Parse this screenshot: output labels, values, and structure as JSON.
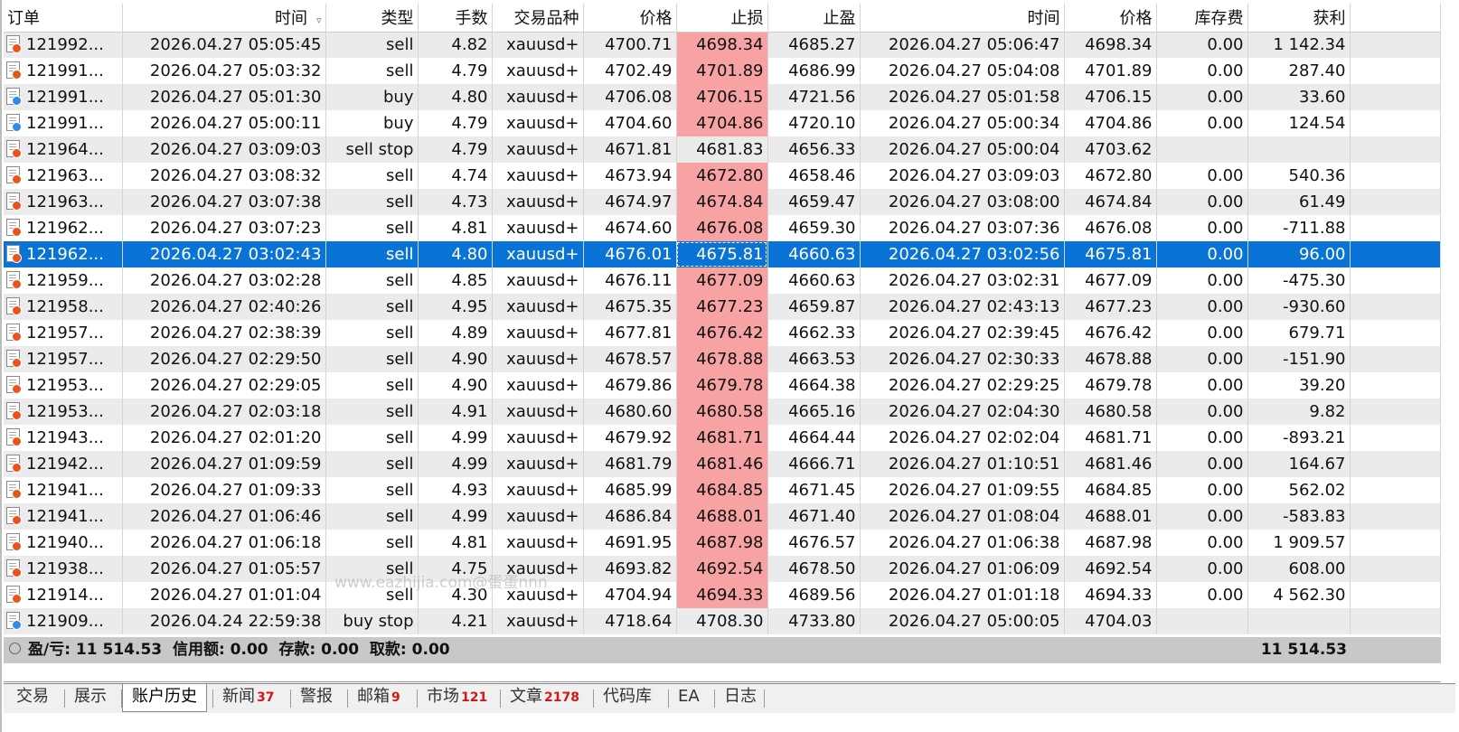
{
  "columns": [
    "订单",
    "时间",
    "类型",
    "手数",
    "交易品种",
    "价格",
    "止损",
    "止盈",
    "时间",
    "价格",
    "库存费",
    "获利"
  ],
  "sort_indicator": "▿",
  "rows": [
    {
      "order": "121992...",
      "open_time": "2026.04.27 05:05:45",
      "type": "sell",
      "volume": "4.82",
      "symbol": "xauusd+",
      "open_price": "4700.71",
      "sl": "4698.34",
      "tp": "4685.27",
      "close_time": "2026.04.27 05:06:47",
      "close_price": "4698.34",
      "swap": "0.00",
      "profit": "1 142.34",
      "sl_hit": true,
      "dot": "red"
    },
    {
      "order": "121991...",
      "open_time": "2026.04.27 05:03:32",
      "type": "sell",
      "volume": "4.79",
      "symbol": "xauusd+",
      "open_price": "4702.49",
      "sl": "4701.89",
      "tp": "4686.99",
      "close_time": "2026.04.27 05:04:08",
      "close_price": "4701.89",
      "swap": "0.00",
      "profit": "287.40",
      "sl_hit": true,
      "dot": "red"
    },
    {
      "order": "121991...",
      "open_time": "2026.04.27 05:01:30",
      "type": "buy",
      "volume": "4.80",
      "symbol": "xauusd+",
      "open_price": "4706.08",
      "sl": "4706.15",
      "tp": "4721.56",
      "close_time": "2026.04.27 05:01:58",
      "close_price": "4706.15",
      "swap": "0.00",
      "profit": "33.60",
      "sl_hit": true,
      "dot": "blue"
    },
    {
      "order": "121991...",
      "open_time": "2026.04.27 05:00:11",
      "type": "buy",
      "volume": "4.79",
      "symbol": "xauusd+",
      "open_price": "4704.60",
      "sl": "4704.86",
      "tp": "4720.10",
      "close_time": "2026.04.27 05:00:34",
      "close_price": "4704.86",
      "swap": "0.00",
      "profit": "124.54",
      "sl_hit": true,
      "dot": "blue"
    },
    {
      "order": "121964...",
      "open_time": "2026.04.27 03:09:03",
      "type": "sell stop",
      "volume": "4.79",
      "symbol": "xauusd+",
      "open_price": "4671.81",
      "sl": "4681.83",
      "tp": "4656.33",
      "close_time": "2026.04.27 05:00:04",
      "close_price": "4703.62",
      "swap": "",
      "profit": "",
      "sl_hit": false,
      "dot": "red"
    },
    {
      "order": "121963...",
      "open_time": "2026.04.27 03:08:32",
      "type": "sell",
      "volume": "4.74",
      "symbol": "xauusd+",
      "open_price": "4673.94",
      "sl": "4672.80",
      "tp": "4658.46",
      "close_time": "2026.04.27 03:09:03",
      "close_price": "4672.80",
      "swap": "0.00",
      "profit": "540.36",
      "sl_hit": true,
      "dot": "red"
    },
    {
      "order": "121963...",
      "open_time": "2026.04.27 03:07:38",
      "type": "sell",
      "volume": "4.73",
      "symbol": "xauusd+",
      "open_price": "4674.97",
      "sl": "4674.84",
      "tp": "4659.47",
      "close_time": "2026.04.27 03:08:00",
      "close_price": "4674.84",
      "swap": "0.00",
      "profit": "61.49",
      "sl_hit": true,
      "dot": "red"
    },
    {
      "order": "121962...",
      "open_time": "2026.04.27 03:07:23",
      "type": "sell",
      "volume": "4.81",
      "symbol": "xauusd+",
      "open_price": "4674.60",
      "sl": "4676.08",
      "tp": "4659.30",
      "close_time": "2026.04.27 03:07:36",
      "close_price": "4676.08",
      "swap": "0.00",
      "profit": "-711.88",
      "sl_hit": true,
      "dot": "red"
    },
    {
      "order": "121962...",
      "open_time": "2026.04.27 03:02:43",
      "type": "sell",
      "volume": "4.80",
      "symbol": "xauusd+",
      "open_price": "4676.01",
      "sl": "4675.81",
      "tp": "4660.63",
      "close_time": "2026.04.27 03:02:56",
      "close_price": "4675.81",
      "swap": "0.00",
      "profit": "96.00",
      "sl_hit": true,
      "dot": "red",
      "selected": true
    },
    {
      "order": "121959...",
      "open_time": "2026.04.27 03:02:28",
      "type": "sell",
      "volume": "4.85",
      "symbol": "xauusd+",
      "open_price": "4676.11",
      "sl": "4677.09",
      "tp": "4660.63",
      "close_time": "2026.04.27 03:02:31",
      "close_price": "4677.09",
      "swap": "0.00",
      "profit": "-475.30",
      "sl_hit": true,
      "dot": "red"
    },
    {
      "order": "121958...",
      "open_time": "2026.04.27 02:40:26",
      "type": "sell",
      "volume": "4.95",
      "symbol": "xauusd+",
      "open_price": "4675.35",
      "sl": "4677.23",
      "tp": "4659.87",
      "close_time": "2026.04.27 02:43:13",
      "close_price": "4677.23",
      "swap": "0.00",
      "profit": "-930.60",
      "sl_hit": true,
      "dot": "red"
    },
    {
      "order": "121957...",
      "open_time": "2026.04.27 02:38:39",
      "type": "sell",
      "volume": "4.89",
      "symbol": "xauusd+",
      "open_price": "4677.81",
      "sl": "4676.42",
      "tp": "4662.33",
      "close_time": "2026.04.27 02:39:45",
      "close_price": "4676.42",
      "swap": "0.00",
      "profit": "679.71",
      "sl_hit": true,
      "dot": "red"
    },
    {
      "order": "121957...",
      "open_time": "2026.04.27 02:29:50",
      "type": "sell",
      "volume": "4.90",
      "symbol": "xauusd+",
      "open_price": "4678.57",
      "sl": "4678.88",
      "tp": "4663.53",
      "close_time": "2026.04.27 02:30:33",
      "close_price": "4678.88",
      "swap": "0.00",
      "profit": "-151.90",
      "sl_hit": true,
      "dot": "red"
    },
    {
      "order": "121953...",
      "open_time": "2026.04.27 02:29:05",
      "type": "sell",
      "volume": "4.90",
      "symbol": "xauusd+",
      "open_price": "4679.86",
      "sl": "4679.78",
      "tp": "4664.38",
      "close_time": "2026.04.27 02:29:25",
      "close_price": "4679.78",
      "swap": "0.00",
      "profit": "39.20",
      "sl_hit": true,
      "dot": "red"
    },
    {
      "order": "121953...",
      "open_time": "2026.04.27 02:03:18",
      "type": "sell",
      "volume": "4.91",
      "symbol": "xauusd+",
      "open_price": "4680.60",
      "sl": "4680.58",
      "tp": "4665.16",
      "close_time": "2026.04.27 02:04:30",
      "close_price": "4680.58",
      "swap": "0.00",
      "profit": "9.82",
      "sl_hit": true,
      "dot": "red"
    },
    {
      "order": "121943...",
      "open_time": "2026.04.27 02:01:20",
      "type": "sell",
      "volume": "4.99",
      "symbol": "xauusd+",
      "open_price": "4679.92",
      "sl": "4681.71",
      "tp": "4664.44",
      "close_time": "2026.04.27 02:02:04",
      "close_price": "4681.71",
      "swap": "0.00",
      "profit": "-893.21",
      "sl_hit": true,
      "dot": "red"
    },
    {
      "order": "121942...",
      "open_time": "2026.04.27 01:09:59",
      "type": "sell",
      "volume": "4.99",
      "symbol": "xauusd+",
      "open_price": "4681.79",
      "sl": "4681.46",
      "tp": "4666.71",
      "close_time": "2026.04.27 01:10:51",
      "close_price": "4681.46",
      "swap": "0.00",
      "profit": "164.67",
      "sl_hit": true,
      "dot": "red"
    },
    {
      "order": "121941...",
      "open_time": "2026.04.27 01:09:33",
      "type": "sell",
      "volume": "4.93",
      "symbol": "xauusd+",
      "open_price": "4685.99",
      "sl": "4684.85",
      "tp": "4671.45",
      "close_time": "2026.04.27 01:09:55",
      "close_price": "4684.85",
      "swap": "0.00",
      "profit": "562.02",
      "sl_hit": true,
      "dot": "red"
    },
    {
      "order": "121941...",
      "open_time": "2026.04.27 01:06:46",
      "type": "sell",
      "volume": "4.99",
      "symbol": "xauusd+",
      "open_price": "4686.84",
      "sl": "4688.01",
      "tp": "4671.40",
      "close_time": "2026.04.27 01:08:04",
      "close_price": "4688.01",
      "swap": "0.00",
      "profit": "-583.83",
      "sl_hit": true,
      "dot": "red"
    },
    {
      "order": "121940...",
      "open_time": "2026.04.27 01:06:18",
      "type": "sell",
      "volume": "4.81",
      "symbol": "xauusd+",
      "open_price": "4691.95",
      "sl": "4687.98",
      "tp": "4676.57",
      "close_time": "2026.04.27 01:06:38",
      "close_price": "4687.98",
      "swap": "0.00",
      "profit": "1 909.57",
      "sl_hit": true,
      "dot": "red"
    },
    {
      "order": "121938...",
      "open_time": "2026.04.27 01:05:57",
      "type": "sell",
      "volume": "4.75",
      "symbol": "xauusd+",
      "open_price": "4693.82",
      "sl": "4692.54",
      "tp": "4678.50",
      "close_time": "2026.04.27 01:06:09",
      "close_price": "4692.54",
      "swap": "0.00",
      "profit": "608.00",
      "sl_hit": true,
      "dot": "red"
    },
    {
      "order": "121914...",
      "open_time": "2026.04.27 01:01:04",
      "type": "sell",
      "volume": "4.30",
      "symbol": "xauusd+",
      "open_price": "4704.94",
      "sl": "4694.33",
      "tp": "4689.56",
      "close_time": "2026.04.27 01:01:18",
      "close_price": "4694.33",
      "swap": "0.00",
      "profit": "4 562.30",
      "sl_hit": true,
      "dot": "red"
    },
    {
      "order": "121909...",
      "open_time": "2026.04.24 22:59:38",
      "type": "buy stop",
      "volume": "4.21",
      "symbol": "xauusd+",
      "open_price": "4718.64",
      "sl": "4708.30",
      "tp": "4733.80",
      "close_time": "2026.04.27 05:00:05",
      "close_price": "4704.03",
      "swap": "",
      "profit": "",
      "sl_hit": false,
      "dot": "blue"
    }
  ],
  "summary": {
    "text": "盈/亏: 11 514.53  信用额: 0.00  存款: 0.00  取款: 0.00",
    "total": "11 514.53"
  },
  "tabs": [
    {
      "label": "交易",
      "badge": ""
    },
    {
      "label": "展示",
      "badge": ""
    },
    {
      "label": "账户历史",
      "badge": "",
      "active": true
    },
    {
      "label": "新闻",
      "badge": "37"
    },
    {
      "label": "警报",
      "badge": ""
    },
    {
      "label": "邮箱",
      "badge": "9"
    },
    {
      "label": "市场",
      "badge": "121"
    },
    {
      "label": "文章",
      "badge": "2178"
    },
    {
      "label": "代码库",
      "badge": ""
    },
    {
      "label": "EA",
      "badge": ""
    },
    {
      "label": "日志",
      "badge": ""
    }
  ],
  "watermark": "www.eazhijia.com@蛋蛋nnn",
  "colors": {
    "selected_row": "#0a74d6",
    "sl_highlight": "#f7a3a3",
    "alt_row": "#ebebeb",
    "summary_bar": "#c8c8c8",
    "badge": "#d01818"
  }
}
